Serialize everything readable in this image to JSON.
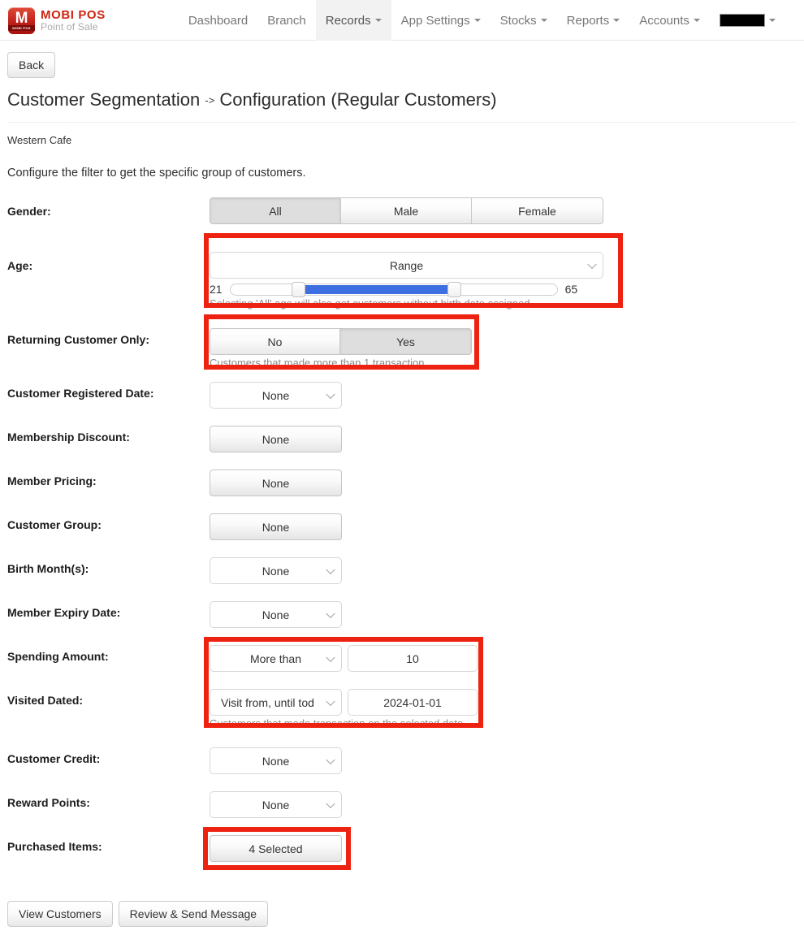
{
  "navbar": {
    "brand": {
      "title": "MOBI POS",
      "subtitle": "Point of Sale",
      "logo_letter": "M",
      "logo_sub": "MOBI POS"
    },
    "items": [
      {
        "label": "Dashboard",
        "has_caret": false,
        "active": false
      },
      {
        "label": "Branch",
        "has_caret": false,
        "active": false
      },
      {
        "label": "Records",
        "has_caret": true,
        "active": true
      },
      {
        "label": "App Settings",
        "has_caret": true,
        "active": false
      },
      {
        "label": "Stocks",
        "has_caret": true,
        "active": false
      },
      {
        "label": "Reports",
        "has_caret": true,
        "active": false
      },
      {
        "label": "Accounts",
        "has_caret": true,
        "active": false
      }
    ],
    "account_redacted": ""
  },
  "page": {
    "back_label": "Back",
    "title_main": "Customer Segmentation",
    "title_arrow": "->",
    "title_sub": "Configuration (Regular Customers)",
    "store_name": "Western Cafe",
    "intro": "Configure the filter to get the specific group of customers."
  },
  "form": {
    "gender": {
      "label": "Gender:",
      "options": [
        "All",
        "Male",
        "Female"
      ],
      "selected": "All"
    },
    "age": {
      "label": "Age:",
      "mode": "Range",
      "min": "21",
      "max": "65",
      "hint": "Selecting 'All' age will also get customers without birth date assigned.",
      "range_min": 21,
      "range_max": 65,
      "scale_min": 0,
      "scale_max": 100
    },
    "returning_customer": {
      "label": "Returning Customer Only:",
      "options": [
        "No",
        "Yes"
      ],
      "selected": "Yes",
      "hint": "Customers that made more than 1 transaction."
    },
    "customer_registered_date": {
      "label": "Customer Registered Date:",
      "value": "None"
    },
    "membership_discount": {
      "label": "Membership Discount:",
      "value": "None"
    },
    "member_pricing": {
      "label": "Member Pricing:",
      "value": "None"
    },
    "customer_group": {
      "label": "Customer Group:",
      "value": "None"
    },
    "birth_months": {
      "label": "Birth Month(s):",
      "value": "None"
    },
    "member_expiry_date": {
      "label": "Member Expiry Date:",
      "value": "None"
    },
    "spending_amount": {
      "label": "Spending Amount:",
      "comparator": "More than",
      "amount": "10"
    },
    "visited_dated": {
      "label": "Visited Dated:",
      "comparator": "Visit from, until tod",
      "date": "2024-01-01",
      "hint": "Customers that made transaction on the selected date."
    },
    "customer_credit": {
      "label": "Customer Credit:",
      "value": "None"
    },
    "reward_points": {
      "label": "Reward Points:",
      "value": "None"
    },
    "purchased_items": {
      "label": "Purchased Items:",
      "value": "4 Selected"
    }
  },
  "actions": {
    "view_customers": "View Customers",
    "review_send": "Review & Send Message"
  },
  "colors": {
    "highlight": "#ee2211",
    "slider_fill": "#3d6fe0",
    "brand_red": "#cf2511"
  }
}
